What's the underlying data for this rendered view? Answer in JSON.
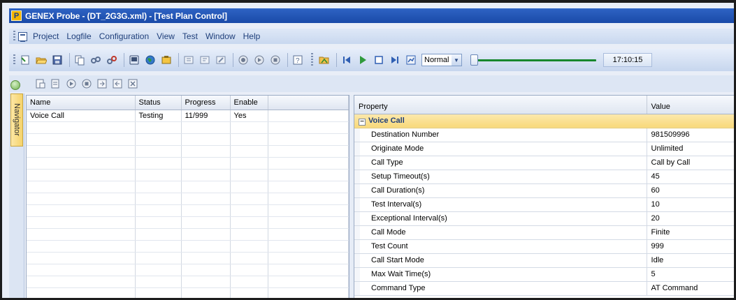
{
  "window": {
    "app_badge": "P",
    "title": "GENEX Probe - (DT_2G3G.xml) - [Test Plan Control]"
  },
  "menu": [
    "Project",
    "Logfile",
    "Configuration",
    "View",
    "Test",
    "Window",
    "Help"
  ],
  "toolbar": {
    "speed_selected": "Normal",
    "playback_progress": 0,
    "time": "17:10:15",
    "icons": [
      "new-icon",
      "open-icon",
      "save-icon",
      "copy-icon",
      "connect-icon",
      "disconnect-icon",
      "device-icon",
      "globe-icon",
      "settings-icon",
      "import-icon",
      "export-icon",
      "edit-icon",
      "record-icon",
      "play-circle-icon",
      "stop-circle-icon",
      "help-icon",
      "open-folder-icon",
      "skip-start-icon",
      "play-icon",
      "stop-icon",
      "skip-end-icon",
      "chart-icon"
    ]
  },
  "navigator": {
    "label": "Navigator"
  },
  "test_list": {
    "columns": [
      "Name",
      "Status",
      "Progress",
      "Enable",
      ""
    ],
    "rows": [
      [
        "Voice Call",
        "Testing",
        "11/999",
        "Yes",
        ""
      ]
    ]
  },
  "properties": {
    "columns": [
      "Property",
      "Value"
    ],
    "category": "Voice Call",
    "rows": [
      {
        "name": "Destination Number",
        "value": "981509996"
      },
      {
        "name": "Originate Mode",
        "value": "Unlimited"
      },
      {
        "name": "Call Type",
        "value": "Call by Call"
      },
      {
        "name": "Setup Timeout(s)",
        "value": "45"
      },
      {
        "name": "Call Duration(s)",
        "value": "60"
      },
      {
        "name": "Test Interval(s)",
        "value": "10"
      },
      {
        "name": "Exceptional Interval(s)",
        "value": "20"
      },
      {
        "name": "Call Mode",
        "value": "Finite"
      },
      {
        "name": "Test Count",
        "value": "999"
      },
      {
        "name": "Call Start Mode",
        "value": "Idle"
      },
      {
        "name": "Max Wait Time(s)",
        "value": "5"
      },
      {
        "name": "Command Type",
        "value": "AT Command"
      }
    ]
  }
}
